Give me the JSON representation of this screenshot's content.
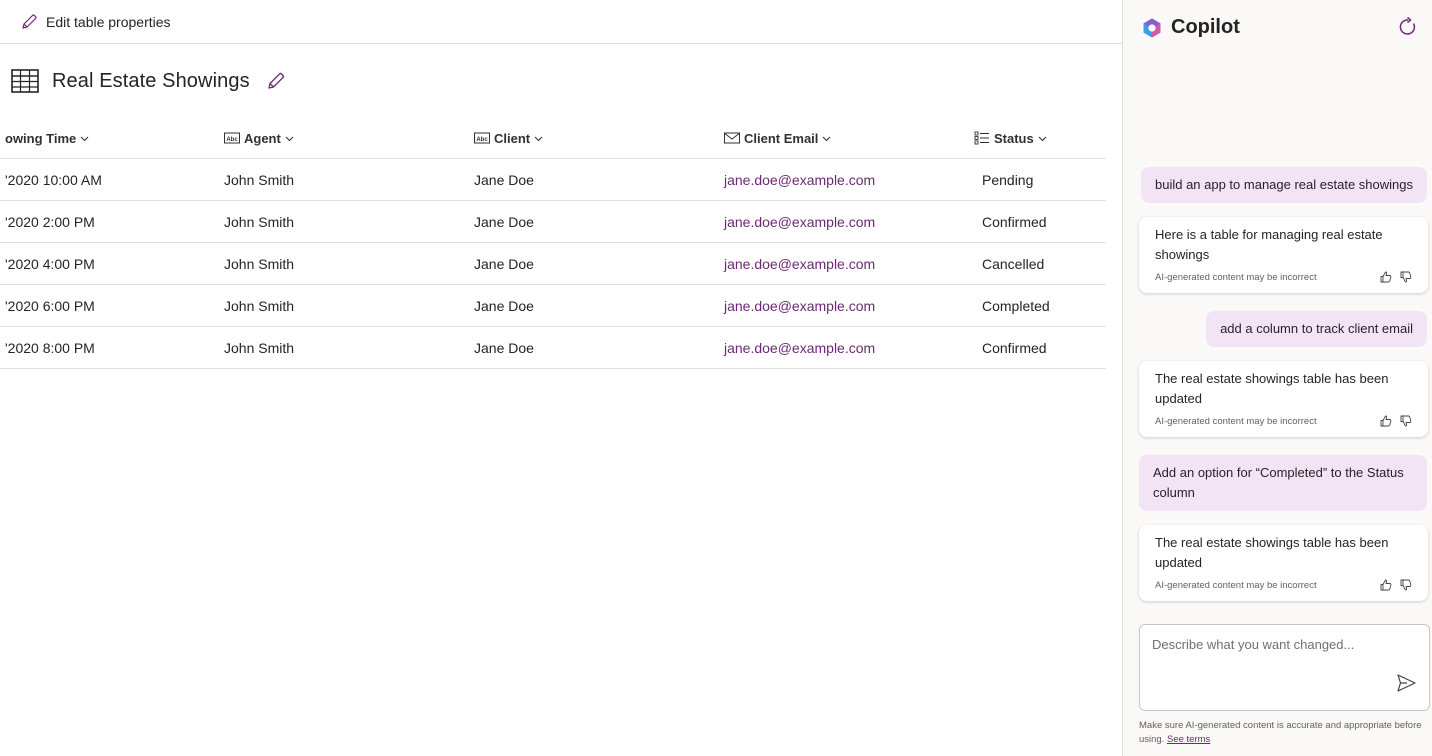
{
  "toolbar": {
    "edit_label": "Edit table properties"
  },
  "table": {
    "title": "Real Estate Showings",
    "columns": [
      {
        "label": "owing Time",
        "icon": "none"
      },
      {
        "label": "Agent",
        "icon": "text-type-icon"
      },
      {
        "label": "Client",
        "icon": "text-type-icon"
      },
      {
        "label": "Client Email",
        "icon": "mail-icon"
      },
      {
        "label": "Status",
        "icon": "choice-list-icon"
      }
    ],
    "rows": [
      [
        "'2020 10:00 AM",
        "John Smith",
        "Jane Doe",
        "jane.doe@example.com",
        "Pending"
      ],
      [
        "'2020 2:00 PM",
        "John Smith",
        "Jane Doe",
        "jane.doe@example.com",
        "Confirmed"
      ],
      [
        "'2020 4:00 PM",
        "John Smith",
        "Jane Doe",
        "jane.doe@example.com",
        "Cancelled"
      ],
      [
        "'2020 6:00 PM",
        "John Smith",
        "Jane Doe",
        "jane.doe@example.com",
        "Completed"
      ],
      [
        "'2020 8:00 PM",
        "John Smith",
        "Jane Doe",
        "jane.doe@example.com",
        "Confirmed"
      ]
    ]
  },
  "copilot": {
    "title": "Copilot",
    "messages": [
      {
        "role": "user",
        "text": "build an app to manage real estate showings"
      },
      {
        "role": "assistant",
        "text": "Here is a table for managing real estate showings",
        "disclaimer": "AI-generated content may be incorrect"
      },
      {
        "role": "user",
        "text": "add a column to track client email"
      },
      {
        "role": "assistant",
        "text": "The real estate showings table has been updated",
        "disclaimer": "AI-generated content may be incorrect"
      },
      {
        "role": "user",
        "text": "Add an option for “Completed” to the Status column"
      },
      {
        "role": "assistant",
        "text": "The real estate showings table has been updated",
        "disclaimer": "AI-generated content may be incorrect"
      }
    ],
    "input_placeholder": "Describe what you want changed...",
    "legal_text": "Make sure AI-generated content is accurate and appropriate before using.",
    "legal_link": "See terms"
  },
  "colors": {
    "accent": "#6b2a73",
    "user_bubble": "#f3e4f5",
    "pane_bg": "#faf9f8"
  }
}
